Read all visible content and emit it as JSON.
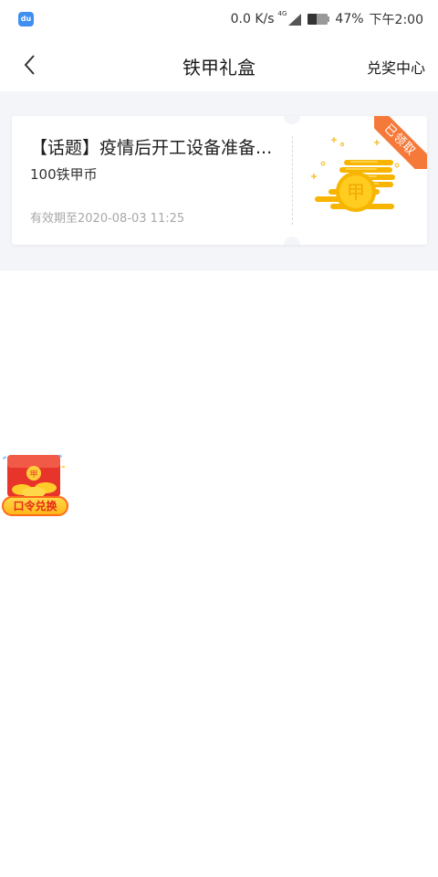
{
  "status_bar": {
    "speed": "0.0 K/s",
    "network": "4G",
    "battery_percent": "47%",
    "time": "下午2:00"
  },
  "nav": {
    "title": "铁甲礼盒",
    "action": "兑奖中心"
  },
  "coupon": {
    "title": "【话题】疫情后开工设备准备...",
    "value": "100铁甲币",
    "expiry": "有效期至2020-08-03 11:25",
    "badge": "已领取",
    "coin_glyph": "甲"
  },
  "float_widget": {
    "label": "口令兑换"
  },
  "colors": {
    "accent": "#f57a3a",
    "coin": "#f7b500",
    "background": "#f3f5f8"
  }
}
